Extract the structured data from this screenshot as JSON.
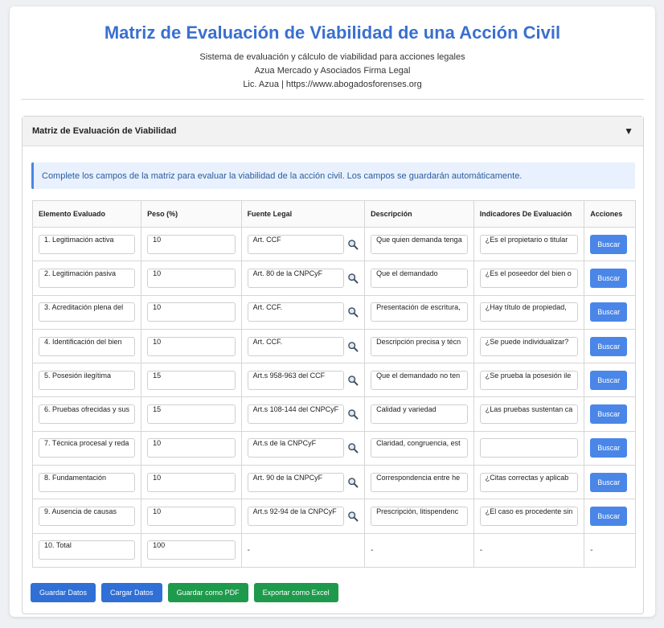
{
  "header": {
    "title": "Matriz de Evaluación de Viabilidad de una Acción Civil",
    "subtitle": "Sistema de evaluación y cálculo de viabilidad para acciones legales",
    "firm": "Azua Mercado y Asociados Firma Legal",
    "contact": "Lic. Azua | https://www.abogadosforenses.org"
  },
  "panel": {
    "title": "Matriz de Evaluación de Viabilidad",
    "toggle": "▼",
    "info": "Complete los campos de la matriz para evaluar la viabilidad de la acción civil. Los campos se guardarán automáticamente."
  },
  "table": {
    "headers": [
      "Elemento Evaluado",
      "Peso (%)",
      "Fuente Legal",
      "Descripción",
      "Indicadores De Evaluación",
      "Acciones"
    ],
    "rows": [
      {
        "elemento": "1. Legitimación activa",
        "peso": "10",
        "fuente": "Art. CCF",
        "descripcion": "Que quien demanda tenga",
        "indicador": "¿Es el propietario o titular",
        "accion": "Buscar"
      },
      {
        "elemento": "2. Legitimación pasiva",
        "peso": "10",
        "fuente": "Art. 80 de la CNPCyF",
        "descripcion": "Que el demandado",
        "indicador": "¿Es el poseedor del bien o",
        "accion": "Buscar"
      },
      {
        "elemento": "3. Acreditación plena del",
        "peso": "10",
        "fuente": "Art. CCF.",
        "descripcion": "Presentación de escritura,",
        "indicador": "¿Hay título de propiedad,",
        "accion": "Buscar"
      },
      {
        "elemento": "4. Identificación del bien",
        "peso": "10",
        "fuente": "Art. CCF.",
        "descripcion": "Descripción precisa y técn",
        "indicador": "¿Se puede individualizar?",
        "accion": "Buscar"
      },
      {
        "elemento": "5. Posesión ilegítima",
        "peso": "15",
        "fuente": "Art.s 958-963 del CCF",
        "descripcion": "Que el demandado no ten",
        "indicador": "¿Se prueba la posesión ile",
        "accion": "Buscar"
      },
      {
        "elemento": "6. Pruebas ofrecidas y sus",
        "peso": "15",
        "fuente": "Art.s 108-144 del CNPCyF",
        "descripcion": "Calidad y variedad",
        "indicador": "¿Las pruebas sustentan ca",
        "accion": "Buscar"
      },
      {
        "elemento": "7. Técnica procesal y reda",
        "peso": "10",
        "fuente": "Art.s de la CNPCyF",
        "descripcion": "Claridad, congruencia, est",
        "indicador": "",
        "accion": "Buscar"
      },
      {
        "elemento": "8. Fundamentación",
        "peso": "10",
        "fuente": "Art. 90 de la CNPCyF",
        "descripcion": "Correspondencia entre he",
        "indicador": "¿Citas correctas y aplicab",
        "accion": "Buscar"
      },
      {
        "elemento": "9. Ausencia de causas",
        "peso": "10",
        "fuente": "Art.s 92-94 de la CNPCyF",
        "descripcion": "Prescripción, litispendenc",
        "indicador": "¿El caso es procedente sin",
        "accion": "Buscar"
      }
    ],
    "total": {
      "elemento": "10. Total",
      "peso": "100",
      "fuente": "-",
      "descripcion": "-",
      "indicador": "-",
      "accion": "-"
    }
  },
  "buttons": {
    "save": "Guardar Datos",
    "load": "Cargar Datos",
    "pdf": "Guardar como PDF",
    "excel": "Exportar como Excel"
  },
  "colors": {
    "title": "#3a6fd0",
    "primary_button": "#4a86e8",
    "save_button": "#2f6fd6",
    "export_button": "#1e9a4c",
    "info_background": "#e8f1fd"
  },
  "icons": {
    "search": "magnifier-icon",
    "toggle": "caret-down-icon"
  }
}
